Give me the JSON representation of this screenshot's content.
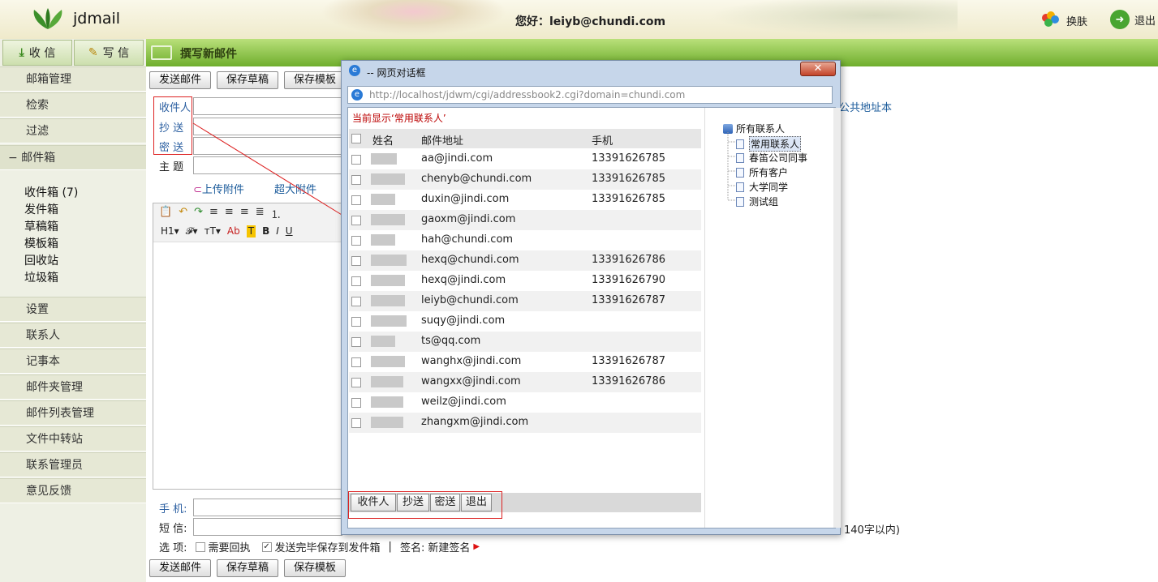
{
  "header": {
    "logo_text": "jdmail",
    "greeting": "您好：leiyb@chundi.com",
    "skin_label": "换肤",
    "exit_label": "退出"
  },
  "toolbar": {
    "receive_label": "收 信",
    "write_label": "写 信",
    "compose_title": "撰写新邮件"
  },
  "sidebar": {
    "items_top": [
      "邮箱管理",
      "检索",
      "过滤"
    ],
    "mailbox_header": "−  邮件箱",
    "folders": [
      "收件箱 (7)",
      "发件箱",
      "草稿箱",
      "模板箱",
      "回收站",
      "垃圾箱"
    ],
    "items_bottom": [
      "设置",
      "联系人",
      "记事本",
      "邮件夹管理",
      "邮件列表管理",
      "文件中转站",
      "联系管理员",
      "意见反馈"
    ]
  },
  "compose": {
    "buttons": [
      "发送邮件",
      "保存草稿",
      "保存模板"
    ],
    "to_label": "收件人",
    "cc_label": "抄 送",
    "bcc_label": "密 送",
    "subject_label": "主 题",
    "upload_label": "上传附件",
    "big_attach_label": "超大附件",
    "public_addr_label": "公共地址本",
    "format_tools": [
      "H1▾",
      "𝓕▾",
      "тT▾",
      "Ab",
      "T",
      "B",
      "I",
      "U"
    ],
    "phone_label": "手 机:",
    "sms_label": "短 信:",
    "sms_hint": "140字以内)",
    "options_label": "选 项:",
    "opt_receipt": "需要回执",
    "opt_save_sent": "发送完毕保存到发件箱",
    "signature_label": "签名:",
    "signature_value": "新建签名",
    "separator": "|"
  },
  "dialog": {
    "title": "-- 网页对话框",
    "close_label": "✕",
    "url": "http://localhost/jdwm/cgi/addressbook2.cgi?domain=chundi.com",
    "current_view": "当前显示‘常用联系人’",
    "columns": [
      "姓名",
      "邮件地址",
      "手机"
    ],
    "rows": [
      {
        "email": "aa@jindi.com",
        "phone": "13391626785"
      },
      {
        "email": "chenyb@chundi.com",
        "phone": "13391626785"
      },
      {
        "email": "duxin@jindi.com",
        "phone": "13391626785"
      },
      {
        "email": "gaoxm@jindi.com",
        "phone": ""
      },
      {
        "email": "hah@chundi.com",
        "phone": ""
      },
      {
        "email": "hexq@chundi.com",
        "phone": "13391626786"
      },
      {
        "email": "hexq@jindi.com",
        "phone": "13391626790"
      },
      {
        "email": "leiyb@chundi.com",
        "phone": "13391626787"
      },
      {
        "email": "suqy@jindi.com",
        "phone": ""
      },
      {
        "email": "ts@qq.com",
        "phone": ""
      },
      {
        "email": "wanghx@jindi.com",
        "phone": "13391626787"
      },
      {
        "email": "wangxx@jindi.com",
        "phone": "13391626786"
      },
      {
        "email": "weilz@jindi.com",
        "phone": ""
      },
      {
        "email": "zhangxm@jindi.com",
        "phone": ""
      }
    ],
    "tree_root": "所有联系人",
    "tree_children": [
      "常用联系人",
      "春笛公司同事",
      "所有客户",
      "大学同学",
      "测试组"
    ],
    "footer_buttons": [
      "收件人",
      "抄送",
      "密送",
      "退出"
    ]
  }
}
